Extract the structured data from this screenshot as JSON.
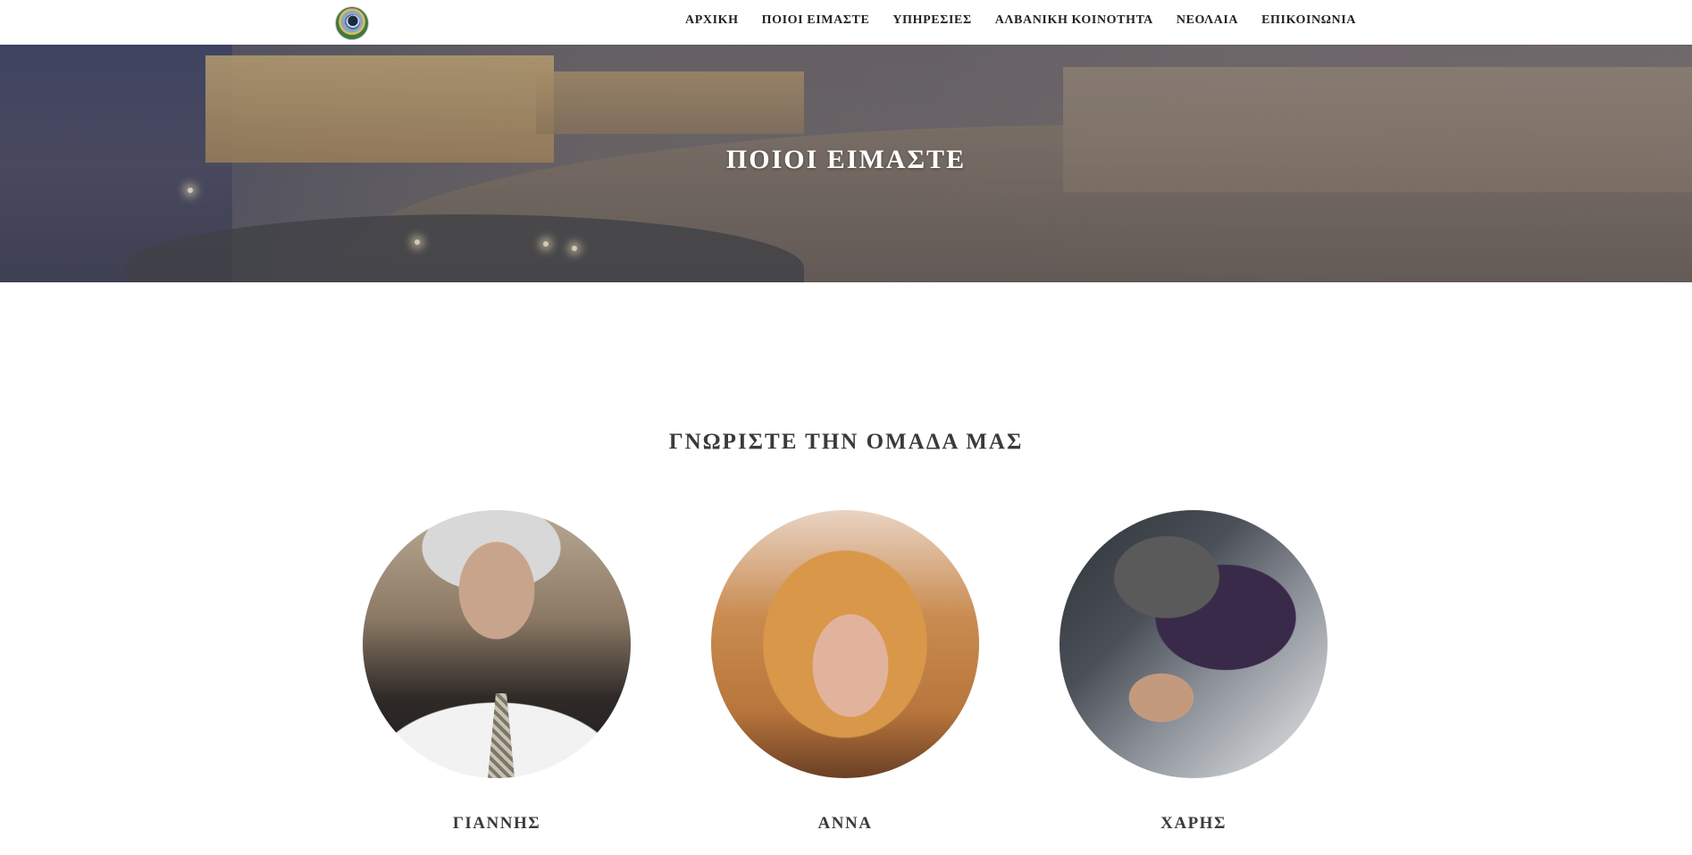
{
  "header": {
    "logo_icon": "community-logo-icon",
    "nav": [
      {
        "label": "ΑΡΧΙΚΗ"
      },
      {
        "label": "ΠΟΙΟΙ ΕΙΜΑΣΤΕ"
      },
      {
        "label": "ΥΠΗΡΕΣΙΕΣ"
      },
      {
        "label": "ΑΛΒΑΝΙΚΗ ΚΟΙΝΟΤΗΤΑ"
      },
      {
        "label": "ΝΕΟΛΑΙΑ"
      },
      {
        "label": "ΕΠΙΚΟΙΝΩΝΙΑ"
      }
    ]
  },
  "hero": {
    "title": "ΠΟΙΟΙ ΕΙΜΑΣΤΕ"
  },
  "team": {
    "heading": "ΓΝΩΡΙΣΤΕ ΤΗΝ ΟΜΑΔΑ ΜΑΣ",
    "members": [
      {
        "name": "ΓΙΑΝΝΗΣ"
      },
      {
        "name": "ΑΝΝΑ"
      },
      {
        "name": "ΧΑΡΗΣ"
      }
    ]
  }
}
